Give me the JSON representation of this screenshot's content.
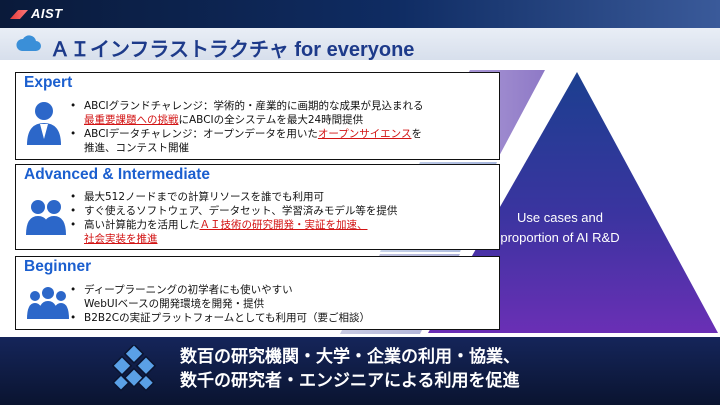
{
  "logo": "AIST",
  "title_jp": "ＡＩインフラストラクチャ",
  "title_en": " for everyone",
  "sections": [
    {
      "heading": "Expert",
      "bullets": [
        [
          "ABCIグランドチャレンジ：学術的・産業的に画期的な成果が見込まれる"
        ],
        [
          "最重要課題への挑戦",
          "にABCIの全システムを最大24時間提供"
        ],
        [
          "ABCIデータチャレンジ：オープンデータを用いた",
          "オープンサイエンス",
          "を"
        ],
        [
          "推進、コンテスト開催"
        ]
      ]
    },
    {
      "heading": "Advanced & Intermediate",
      "bullets": [
        [
          "最大512ノードまでの計算リソースを誰でも利用可"
        ],
        [
          "すぐ使えるソフトウェア、データセット、学習済みモデル等を提供"
        ],
        [
          "高い計算能力を活用した",
          "ＡＩ技術の研究開発・実証を加速、"
        ],
        [
          "社会実装を推進"
        ]
      ]
    },
    {
      "heading": "Beginner",
      "bullets": [
        [
          "ディープラーニングの初学者にも使いやすい"
        ],
        [
          "WebUIベースの開発環境を開発・提供"
        ],
        [
          "B2B2Cの実証プラットフォームとしても利用可（要ご相談）"
        ]
      ]
    }
  ],
  "pyramid_text": [
    "Use cases and",
    "proportion of AI R&D"
  ],
  "footer": [
    "数百の研究機関・大学・企業の利用・協業、",
    "数千の研究者・エンジニアによる利用を促進"
  ],
  "colors": {
    "heading": "#1b5fcf",
    "emphasis": "#d21313",
    "title": "#1d3a8a"
  }
}
